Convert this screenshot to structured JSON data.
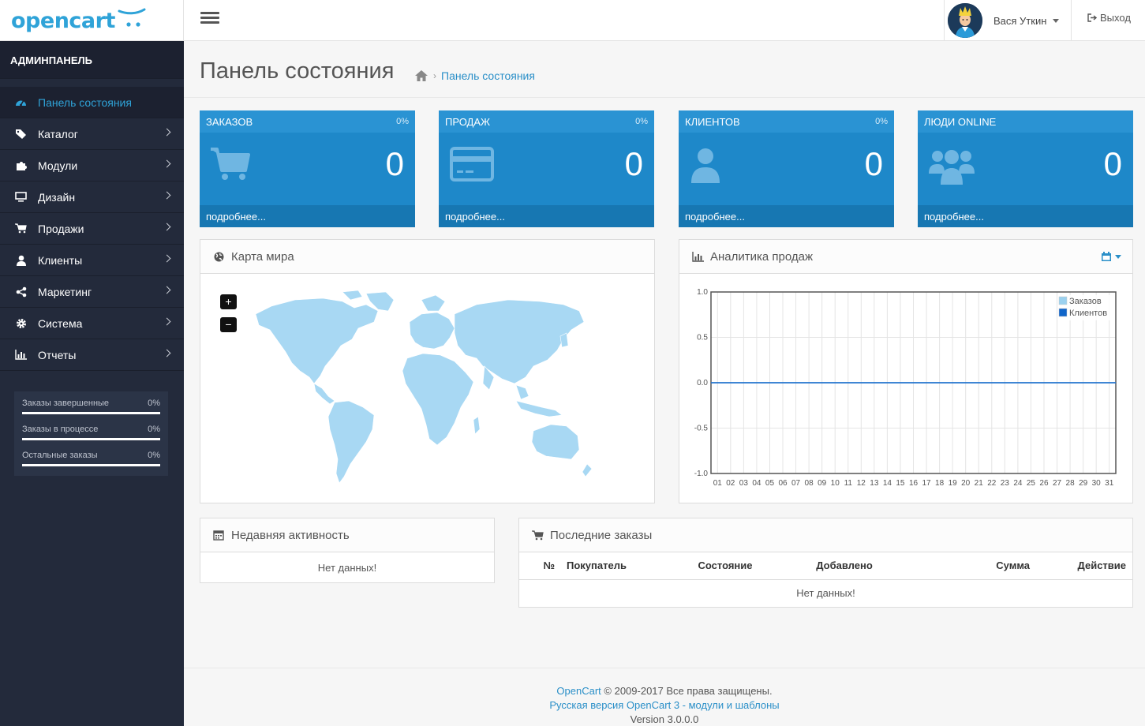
{
  "header": {
    "logo_text": "opencart",
    "user_name": "Вася Уткин",
    "logout_label": "Выход"
  },
  "sidebar": {
    "title": "АДМИНПАНЕЛЬ",
    "items": [
      {
        "label": "Панель состояния",
        "icon": "dashboard-icon",
        "active": true
      },
      {
        "label": "Каталог",
        "icon": "tag-icon"
      },
      {
        "label": "Модули",
        "icon": "puzzle-icon"
      },
      {
        "label": "Дизайн",
        "icon": "monitor-icon"
      },
      {
        "label": "Продажи",
        "icon": "cart-icon"
      },
      {
        "label": "Клиенты",
        "icon": "user-icon"
      },
      {
        "label": "Маркетинг",
        "icon": "share-icon"
      },
      {
        "label": "Система",
        "icon": "gear-icon"
      },
      {
        "label": "Отчеты",
        "icon": "bar-chart-icon"
      }
    ],
    "stats": [
      {
        "label": "Заказы завершенные",
        "value": "0%"
      },
      {
        "label": "Заказы в процессе",
        "value": "0%"
      },
      {
        "label": "Остальные заказы",
        "value": "0%"
      }
    ]
  },
  "page": {
    "title": "Панель состояния",
    "breadcrumb": "Панель состояния"
  },
  "tiles": [
    {
      "title": "ЗАКАЗОВ",
      "percent": "0%",
      "value": "0",
      "footer": "подробнее...",
      "icon": "cart-icon"
    },
    {
      "title": "ПРОДАЖ",
      "percent": "0%",
      "value": "0",
      "footer": "подробнее...",
      "icon": "credit-card-icon"
    },
    {
      "title": "КЛИЕНТОВ",
      "percent": "0%",
      "value": "0",
      "footer": "подробнее...",
      "icon": "user-icon"
    },
    {
      "title": "ЛЮДИ ONLINE",
      "percent": "",
      "value": "0",
      "footer": "подробнее...",
      "icon": "users-icon"
    }
  ],
  "map_panel": {
    "title": "Карта мира",
    "zoom_in": "+",
    "zoom_out": "−"
  },
  "chart_panel": {
    "title": "Аналитика продаж"
  },
  "chart_data": {
    "type": "line",
    "x": [
      "01",
      "02",
      "03",
      "04",
      "05",
      "06",
      "07",
      "08",
      "09",
      "10",
      "11",
      "12",
      "13",
      "14",
      "15",
      "16",
      "17",
      "18",
      "19",
      "20",
      "21",
      "22",
      "23",
      "24",
      "25",
      "26",
      "27",
      "28",
      "29",
      "30",
      "31"
    ],
    "series": [
      {
        "name": "Заказов",
        "color": "#9bd1ef",
        "values": [
          0,
          0,
          0,
          0,
          0,
          0,
          0,
          0,
          0,
          0,
          0,
          0,
          0,
          0,
          0,
          0,
          0,
          0,
          0,
          0,
          0,
          0,
          0,
          0,
          0,
          0,
          0,
          0,
          0,
          0,
          0
        ]
      },
      {
        "name": "Клиентов",
        "color": "#1065c9",
        "values": [
          0,
          0,
          0,
          0,
          0,
          0,
          0,
          0,
          0,
          0,
          0,
          0,
          0,
          0,
          0,
          0,
          0,
          0,
          0,
          0,
          0,
          0,
          0,
          0,
          0,
          0,
          0,
          0,
          0,
          0,
          0
        ]
      }
    ],
    "y_ticks": [
      "1.0",
      "0.5",
      "0.0",
      "-0.5",
      "-1.0"
    ],
    "ylim": [
      -1.0,
      1.0
    ],
    "grid": true,
    "legend": "top-right"
  },
  "activity_panel": {
    "title": "Недавняя активность",
    "empty": "Нет данных!"
  },
  "orders_panel": {
    "title": "Последние заказы",
    "columns": [
      "№",
      "Покупатель",
      "Состояние",
      "Добавлено",
      "Сумма",
      "Действие"
    ],
    "empty": "Нет данных!"
  },
  "footer": {
    "link1": "OpenCart",
    "copyright": " © 2009-2017 Все права защищены.",
    "link2": "Русская версия OpenCart 3 - модули и шаблоны",
    "version": "Version 3.0.0.0"
  },
  "colors": {
    "accent": "#1e88c9",
    "sidebar": "#232a3b",
    "link": "#2a8fc8",
    "map_land": "#a8d8f3"
  }
}
